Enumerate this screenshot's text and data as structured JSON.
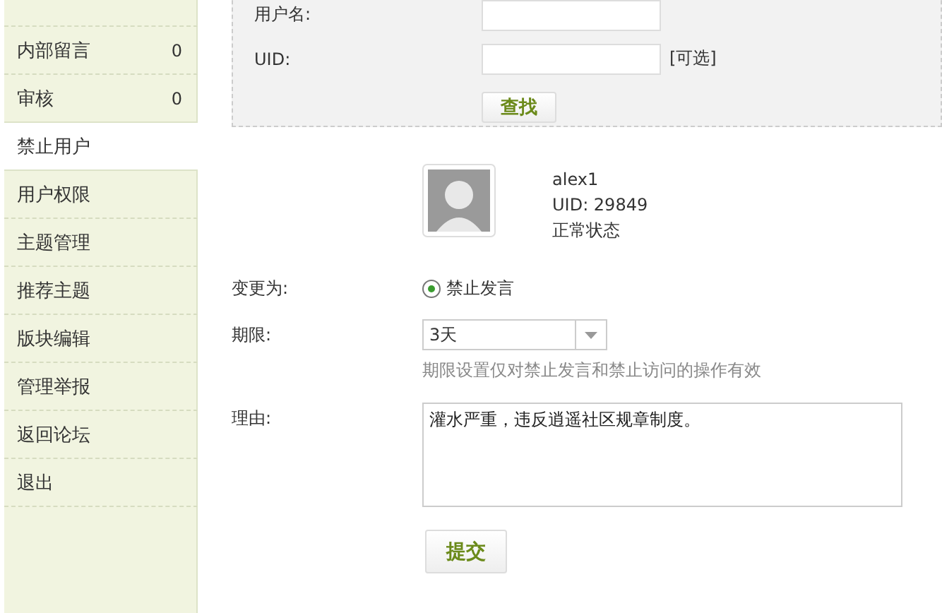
{
  "sidebar": {
    "items": [
      {
        "label": "内部留言",
        "count": "0",
        "selected": false
      },
      {
        "label": "审核",
        "count": "0",
        "selected": false
      },
      {
        "label": "禁止用户",
        "selected": true
      },
      {
        "label": "用户权限",
        "selected": false
      },
      {
        "label": "主题管理",
        "selected": false
      },
      {
        "label": "推荐主题",
        "selected": false
      },
      {
        "label": "版块编辑",
        "selected": false
      },
      {
        "label": "管理举报",
        "selected": false
      },
      {
        "label": "返回论坛",
        "selected": false
      },
      {
        "label": "退出",
        "selected": false
      }
    ]
  },
  "search": {
    "username_label": "用户名:",
    "uid_label": "UID:",
    "uid_note": "[可选]",
    "button": "查找"
  },
  "user": {
    "name": "alex1",
    "uid": "UID: 29849",
    "status": "正常状态"
  },
  "form": {
    "change_label": "变更为:",
    "change_option": {
      "label": "禁止发言",
      "selected": true
    },
    "period_label": "期限:",
    "period_value": "3天",
    "period_hint": "期限设置仅对禁止发言和禁止访问的操作有效",
    "reason_label": "理由:",
    "reason_value": "灌水严重，违反逍遥社区规章制度。",
    "submit": "提交"
  }
}
